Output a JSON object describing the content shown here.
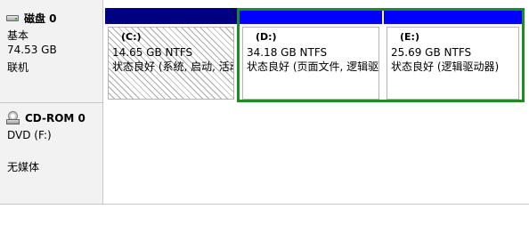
{
  "disk0": {
    "title": "磁盘 0",
    "type": "基本",
    "size": "74.53 GB",
    "status": "联机",
    "icon": "hard-disk-icon",
    "partitions": [
      {
        "label": "(C:)",
        "size": "14.65 GB NTFS",
        "status": "状态良好 (系统, 启动, 活动",
        "selected": false
      },
      {
        "label": "(D:)",
        "size": "34.18 GB NTFS",
        "status": "状态良好 (页面文件, 逻辑驱",
        "selected": true
      },
      {
        "label": "(E:)",
        "size": "25.69 GB NTFS",
        "status": "状态良好 (逻辑驱动器)",
        "selected": true
      }
    ]
  },
  "cdrom0": {
    "title": "CD-ROM 0",
    "drive": "DVD (F:)",
    "media": "无媒体",
    "icon": "cd-rom-icon"
  },
  "colors": {
    "primary_partition_header": "#000080",
    "logical_partition_header": "#0000ff",
    "selection_border": "#1e8c1e",
    "label_panel": "#f2f2f2"
  }
}
